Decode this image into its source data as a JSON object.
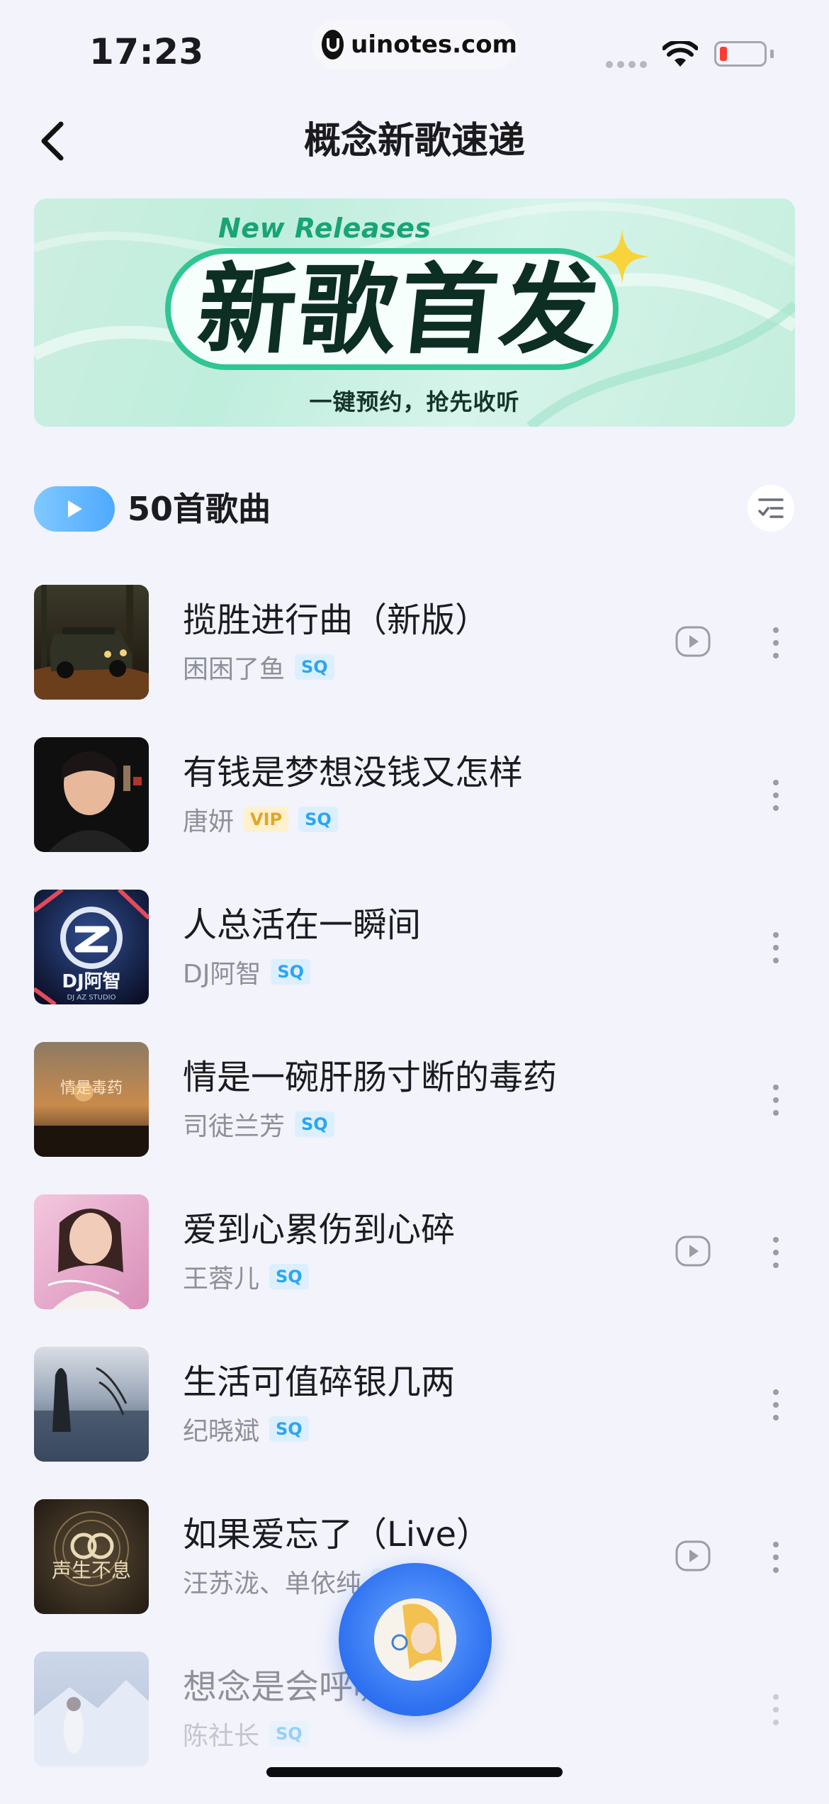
{
  "status_bar": {
    "time": "17:23",
    "url": "uinotes.com"
  },
  "header": {
    "title": "概念新歌速递"
  },
  "banner": {
    "subtitle_en": "New Releases",
    "title": "新歌首发",
    "tagline": "一键预约，抢先收听"
  },
  "playlist": {
    "song_count": "50首歌曲"
  },
  "songs": [
    {
      "title": "揽胜进行曲（新版）",
      "artist": "困困了鱼",
      "tags": [
        "SQ"
      ]
    },
    {
      "title": "有钱是梦想没钱又怎样",
      "artist": "唐妍",
      "tags": [
        "VIP",
        "SQ"
      ]
    },
    {
      "title": "人总活在一瞬间",
      "artist": "DJ阿智",
      "tags": [
        "SQ"
      ]
    },
    {
      "title": "情是一碗肝肠寸断的毒药",
      "artist": "司徒兰芳",
      "tags": [
        "SQ"
      ]
    },
    {
      "title": "爱到心累伤到心碎",
      "artist": "王蓉儿",
      "tags": [
        "SQ"
      ]
    },
    {
      "title": "生活可值碎银几两",
      "artist": "纪晓斌",
      "tags": [
        "SQ"
      ]
    },
    {
      "title": "如果爱忘了（Live）",
      "artist": "汪苏泷、单依纯",
      "tags": [
        "SQ"
      ]
    },
    {
      "title": "想念是会呼吸",
      "artist": "陈社长",
      "tags": [
        "SQ"
      ]
    }
  ],
  "covers": {
    "cover3_text": "DJ阿智",
    "cover3_sub": "DJ AZ STUDIO",
    "cover4_text": "情是毒药",
    "cover7_text": "声生不息"
  },
  "colors": {
    "accent": "#4fa9ff",
    "sq_tag": "#2aa6f0",
    "vip_tag": "#e1a528",
    "background": "#f2f3fb"
  },
  "icons": {
    "back": "chevron-left-icon",
    "play_all": "play-icon",
    "sort": "sort-list-icon",
    "mv": "mv-play-icon",
    "more": "more-vertical-icon"
  }
}
